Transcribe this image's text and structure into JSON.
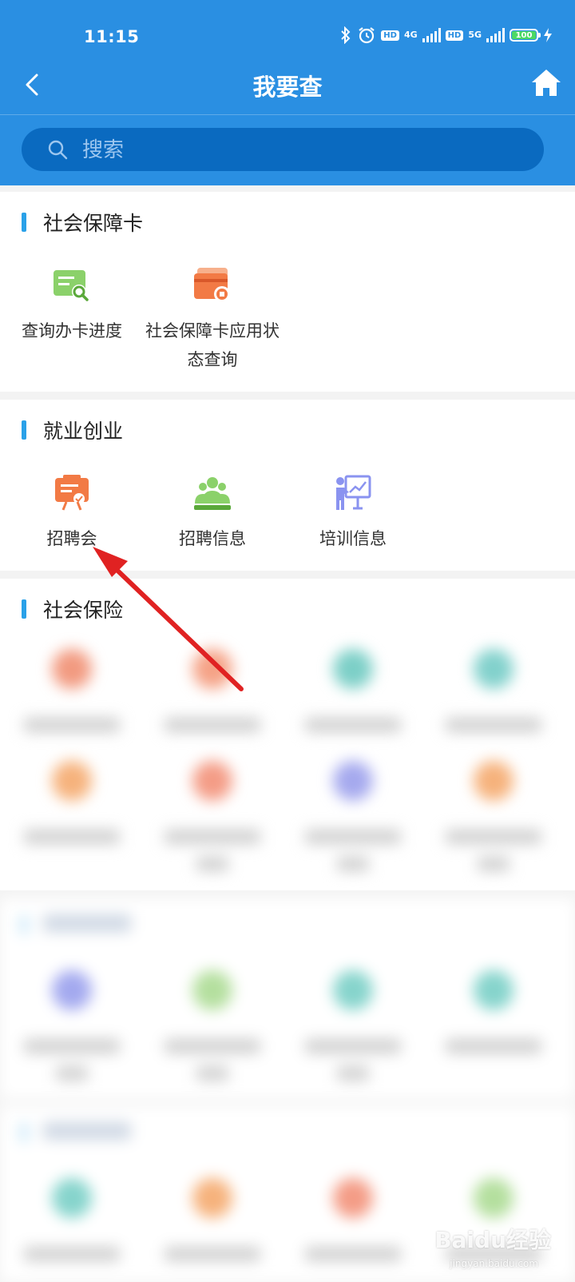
{
  "status_bar": {
    "time": "11:15",
    "network_1": "4G",
    "network_2": "5G",
    "hd_label": "HD",
    "battery": "100"
  },
  "nav": {
    "title": "我要查"
  },
  "search": {
    "placeholder": "搜索"
  },
  "sections": [
    {
      "title": "社会保障卡",
      "items": [
        {
          "label": "查询办卡进度",
          "icon": "card-search-icon"
        },
        {
          "label": "社会保障卡应用状态查询",
          "icon": "card-status-icon"
        }
      ]
    },
    {
      "title": "就业创业",
      "items": [
        {
          "label": "招聘会",
          "icon": "job-fair-icon"
        },
        {
          "label": "招聘信息",
          "icon": "recruitment-info-icon"
        },
        {
          "label": "培训信息",
          "icon": "training-info-icon"
        }
      ]
    },
    {
      "title": "社会保险"
    }
  ],
  "colors": {
    "header": "#2a8fe2",
    "search_bg": "#0a6ac0",
    "section_accent": "#2aa1e8",
    "arrow": "#e02222"
  },
  "watermark": {
    "text": "Baidu经验",
    "sub": "jingyan.baidu.com"
  }
}
